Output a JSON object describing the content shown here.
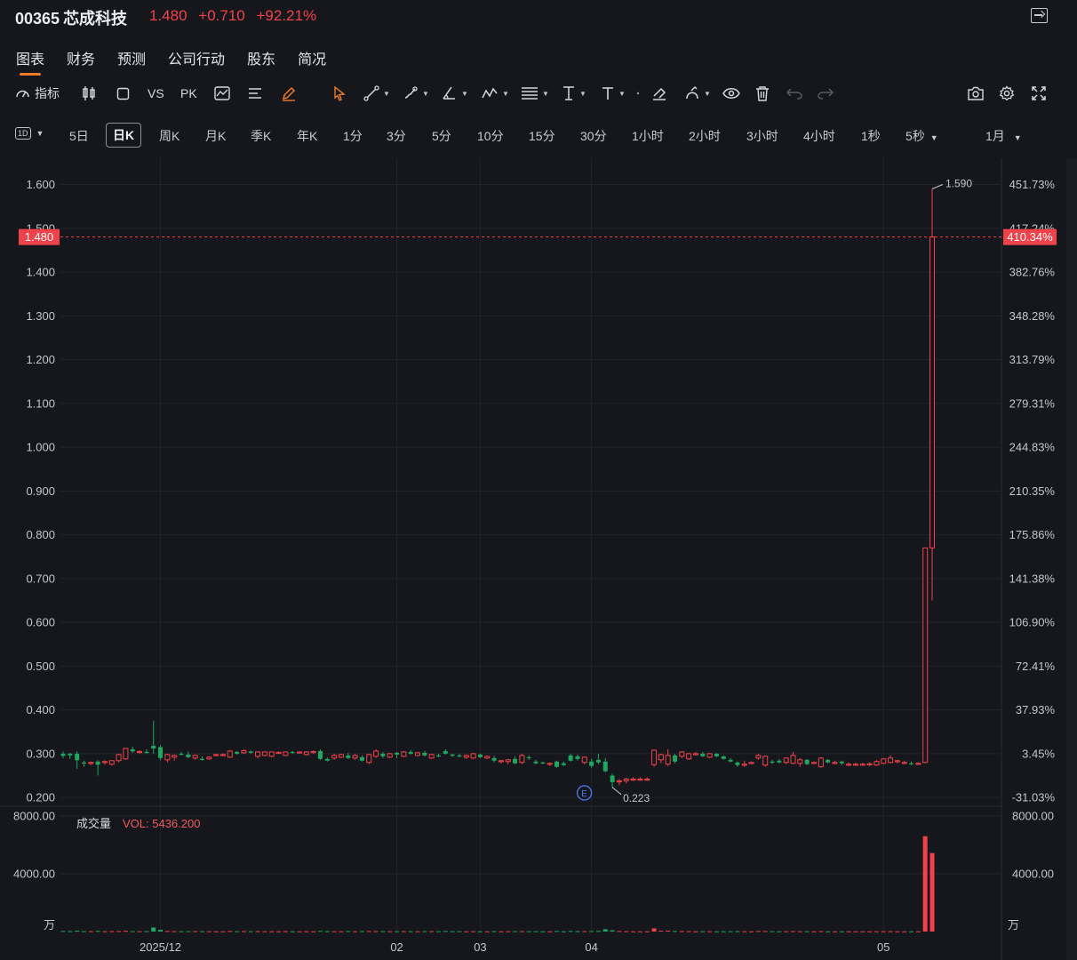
{
  "header": {
    "code": "00365",
    "name": "芯成科技",
    "price": "1.480",
    "change": "+0.710",
    "change_pct": "+92.21%"
  },
  "tabs": [
    "图表",
    "财务",
    "预测",
    "公司行动",
    "股东",
    "简况"
  ],
  "active_tab": "图表",
  "toolbar": {
    "indicator_label": "指标",
    "vs_label": "VS",
    "pk_label": "PK"
  },
  "periods": {
    "interval_selector": "1D",
    "items": [
      "5日",
      "日K",
      "周K",
      "月K",
      "季K",
      "年K",
      "1分",
      "3分",
      "5分",
      "10分",
      "15分",
      "30分",
      "1小时",
      "2小时",
      "3小时",
      "4小时",
      "1秒",
      "5秒"
    ],
    "active": "日K",
    "range": "1月"
  },
  "colors": {
    "up": "#f0424a",
    "down": "#1fa663",
    "accent": "#f07b25",
    "background": "#16171c"
  },
  "chart_data": {
    "type": "candlestick",
    "price_axis": {
      "ticks": [
        "1.600",
        "1.500",
        "1.400",
        "1.300",
        "1.200",
        "1.100",
        "1.000",
        "0.900",
        "0.800",
        "0.700",
        "0.600",
        "0.500",
        "0.400",
        "0.300",
        "0.200"
      ],
      "range": [
        0.18,
        1.66
      ]
    },
    "pct_axis": {
      "ticks": [
        "451.73%",
        "417.24%",
        "382.76%",
        "348.28%",
        "313.79%",
        "279.31%",
        "244.83%",
        "210.35%",
        "175.86%",
        "141.38%",
        "106.90%",
        "72.41%",
        "37.93%",
        "3.45%",
        "-31.03%"
      ]
    },
    "current_price_label": "1.480",
    "current_pct_label": "410.34%",
    "high_label": "1.590",
    "low_label": "0.223",
    "earnings_marker": "E",
    "x_labels": [
      "2025/12",
      "02",
      "03",
      "04",
      "05"
    ],
    "volume": {
      "title": "成交量",
      "indicator": "VOL: 5436.200",
      "axis_ticks": [
        "8000.00",
        "4000.00",
        "万"
      ],
      "range": [
        0,
        8000
      ]
    },
    "candles": [
      {
        "o": 0.3,
        "h": 0.305,
        "l": 0.29,
        "c": 0.295,
        "v": 40
      },
      {
        "o": 0.3,
        "h": 0.302,
        "l": 0.288,
        "c": 0.296,
        "v": 30
      },
      {
        "o": 0.3,
        "h": 0.305,
        "l": 0.265,
        "c": 0.285,
        "v": 60
      },
      {
        "o": 0.28,
        "h": 0.284,
        "l": 0.27,
        "c": 0.278,
        "v": 30
      },
      {
        "o": 0.278,
        "h": 0.282,
        "l": 0.274,
        "c": 0.28,
        "v": 25
      },
      {
        "o": 0.282,
        "h": 0.285,
        "l": 0.25,
        "c": 0.275,
        "v": 45
      },
      {
        "o": 0.28,
        "h": 0.285,
        "l": 0.275,
        "c": 0.282,
        "v": 20
      },
      {
        "o": 0.276,
        "h": 0.285,
        "l": 0.273,
        "c": 0.284,
        "v": 25
      },
      {
        "o": 0.284,
        "h": 0.3,
        "l": 0.28,
        "c": 0.298,
        "v": 35
      },
      {
        "o": 0.288,
        "h": 0.312,
        "l": 0.286,
        "c": 0.312,
        "v": 50
      },
      {
        "o": 0.31,
        "h": 0.316,
        "l": 0.302,
        "c": 0.305,
        "v": 30
      },
      {
        "o": 0.304,
        "h": 0.308,
        "l": 0.3,
        "c": 0.305,
        "v": 20
      },
      {
        "o": 0.304,
        "h": 0.31,
        "l": 0.3,
        "c": 0.302,
        "v": 25
      },
      {
        "o": 0.318,
        "h": 0.375,
        "l": 0.3,
        "c": 0.312,
        "v": 280
      },
      {
        "o": 0.315,
        "h": 0.32,
        "l": 0.285,
        "c": 0.29,
        "v": 120
      },
      {
        "o": 0.286,
        "h": 0.3,
        "l": 0.28,
        "c": 0.298,
        "v": 40
      },
      {
        "o": 0.292,
        "h": 0.298,
        "l": 0.284,
        "c": 0.296,
        "v": 30
      },
      {
        "o": 0.3,
        "h": 0.304,
        "l": 0.296,
        "c": 0.298,
        "v": 20
      },
      {
        "o": 0.298,
        "h": 0.305,
        "l": 0.29,
        "c": 0.292,
        "v": 30
      },
      {
        "o": 0.29,
        "h": 0.298,
        "l": 0.286,
        "c": 0.296,
        "v": 25
      },
      {
        "o": 0.288,
        "h": 0.294,
        "l": 0.284,
        "c": 0.286,
        "v": 20
      },
      {
        "o": 0.288,
        "h": 0.294,
        "l": 0.286,
        "c": 0.292,
        "v": 20
      },
      {
        "o": 0.298,
        "h": 0.3,
        "l": 0.294,
        "c": 0.298,
        "v": 15
      },
      {
        "o": 0.298,
        "h": 0.301,
        "l": 0.296,
        "c": 0.298,
        "v": 15
      },
      {
        "o": 0.292,
        "h": 0.308,
        "l": 0.29,
        "c": 0.306,
        "v": 40
      },
      {
        "o": 0.304,
        "h": 0.306,
        "l": 0.298,
        "c": 0.3,
        "v": 20
      },
      {
        "o": 0.302,
        "h": 0.31,
        "l": 0.3,
        "c": 0.307,
        "v": 30
      },
      {
        "o": 0.305,
        "h": 0.307,
        "l": 0.3,
        "c": 0.302,
        "v": 20
      },
      {
        "o": 0.294,
        "h": 0.306,
        "l": 0.29,
        "c": 0.304,
        "v": 25
      },
      {
        "o": 0.296,
        "h": 0.305,
        "l": 0.294,
        "c": 0.304,
        "v": 20
      },
      {
        "o": 0.294,
        "h": 0.305,
        "l": 0.292,
        "c": 0.304,
        "v": 20
      },
      {
        "o": 0.303,
        "h": 0.305,
        "l": 0.3,
        "c": 0.303,
        "v": 15
      },
      {
        "o": 0.296,
        "h": 0.305,
        "l": 0.294,
        "c": 0.304,
        "v": 25
      },
      {
        "o": 0.304,
        "h": 0.306,
        "l": 0.3,
        "c": 0.302,
        "v": 15
      },
      {
        "o": 0.303,
        "h": 0.305,
        "l": 0.3,
        "c": 0.304,
        "v": 15
      },
      {
        "o": 0.298,
        "h": 0.306,
        "l": 0.296,
        "c": 0.304,
        "v": 20
      },
      {
        "o": 0.304,
        "h": 0.307,
        "l": 0.3,
        "c": 0.305,
        "v": 15
      },
      {
        "o": 0.306,
        "h": 0.31,
        "l": 0.286,
        "c": 0.288,
        "v": 40
      },
      {
        "o": 0.288,
        "h": 0.292,
        "l": 0.282,
        "c": 0.284,
        "v": 25
      },
      {
        "o": 0.29,
        "h": 0.3,
        "l": 0.286,
        "c": 0.296,
        "v": 20
      },
      {
        "o": 0.292,
        "h": 0.3,
        "l": 0.29,
        "c": 0.298,
        "v": 20
      },
      {
        "o": 0.296,
        "h": 0.302,
        "l": 0.288,
        "c": 0.29,
        "v": 30
      },
      {
        "o": 0.29,
        "h": 0.299,
        "l": 0.286,
        "c": 0.296,
        "v": 25
      },
      {
        "o": 0.292,
        "h": 0.296,
        "l": 0.282,
        "c": 0.284,
        "v": 30
      },
      {
        "o": 0.28,
        "h": 0.3,
        "l": 0.276,
        "c": 0.298,
        "v": 35
      },
      {
        "o": 0.294,
        "h": 0.31,
        "l": 0.29,
        "c": 0.306,
        "v": 30
      },
      {
        "o": 0.3,
        "h": 0.304,
        "l": 0.29,
        "c": 0.294,
        "v": 25
      },
      {
        "o": 0.292,
        "h": 0.302,
        "l": 0.29,
        "c": 0.3,
        "v": 20
      },
      {
        "o": 0.302,
        "h": 0.304,
        "l": 0.29,
        "c": 0.298,
        "v": 20
      },
      {
        "o": 0.294,
        "h": 0.306,
        "l": 0.292,
        "c": 0.304,
        "v": 25
      },
      {
        "o": 0.304,
        "h": 0.308,
        "l": 0.298,
        "c": 0.3,
        "v": 20
      },
      {
        "o": 0.296,
        "h": 0.304,
        "l": 0.294,
        "c": 0.302,
        "v": 20
      },
      {
        "o": 0.302,
        "h": 0.306,
        "l": 0.294,
        "c": 0.296,
        "v": 30
      },
      {
        "o": 0.29,
        "h": 0.3,
        "l": 0.288,
        "c": 0.298,
        "v": 25
      },
      {
        "o": 0.296,
        "h": 0.3,
        "l": 0.292,
        "c": 0.294,
        "v": 20
      },
      {
        "o": 0.306,
        "h": 0.31,
        "l": 0.298,
        "c": 0.3,
        "v": 40
      },
      {
        "o": 0.298,
        "h": 0.3,
        "l": 0.292,
        "c": 0.296,
        "v": 20
      },
      {
        "o": 0.296,
        "h": 0.3,
        "l": 0.292,
        "c": 0.294,
        "v": 20
      },
      {
        "o": 0.292,
        "h": 0.298,
        "l": 0.288,
        "c": 0.296,
        "v": 15
      },
      {
        "o": 0.29,
        "h": 0.302,
        "l": 0.288,
        "c": 0.3,
        "v": 20
      },
      {
        "o": 0.298,
        "h": 0.3,
        "l": 0.29,
        "c": 0.292,
        "v": 15
      },
      {
        "o": 0.29,
        "h": 0.296,
        "l": 0.288,
        "c": 0.294,
        "v": 15
      },
      {
        "o": 0.29,
        "h": 0.295,
        "l": 0.28,
        "c": 0.284,
        "v": 25
      },
      {
        "o": 0.282,
        "h": 0.286,
        "l": 0.278,
        "c": 0.284,
        "v": 15
      },
      {
        "o": 0.282,
        "h": 0.288,
        "l": 0.276,
        "c": 0.286,
        "v": 20
      },
      {
        "o": 0.288,
        "h": 0.294,
        "l": 0.276,
        "c": 0.278,
        "v": 30
      },
      {
        "o": 0.28,
        "h": 0.3,
        "l": 0.276,
        "c": 0.296,
        "v": 30
      },
      {
        "o": 0.292,
        "h": 0.296,
        "l": 0.286,
        "c": 0.29,
        "v": 20
      },
      {
        "o": 0.282,
        "h": 0.286,
        "l": 0.276,
        "c": 0.278,
        "v": 20
      },
      {
        "o": 0.28,
        "h": 0.282,
        "l": 0.276,
        "c": 0.278,
        "v": 15
      },
      {
        "o": 0.276,
        "h": 0.28,
        "l": 0.272,
        "c": 0.278,
        "v": 15
      },
      {
        "o": 0.282,
        "h": 0.284,
        "l": 0.268,
        "c": 0.27,
        "v": 40
      },
      {
        "o": 0.278,
        "h": 0.282,
        "l": 0.272,
        "c": 0.274,
        "v": 15
      },
      {
        "o": 0.296,
        "h": 0.3,
        "l": 0.282,
        "c": 0.284,
        "v": 40
      },
      {
        "o": 0.294,
        "h": 0.298,
        "l": 0.284,
        "c": 0.288,
        "v": 25
      },
      {
        "o": 0.28,
        "h": 0.294,
        "l": 0.276,
        "c": 0.292,
        "v": 25
      },
      {
        "o": 0.282,
        "h": 0.288,
        "l": 0.268,
        "c": 0.272,
        "v": 30
      },
      {
        "o": 0.286,
        "h": 0.3,
        "l": 0.276,
        "c": 0.28,
        "v": 40
      },
      {
        "o": 0.282,
        "h": 0.29,
        "l": 0.258,
        "c": 0.26,
        "v": 160
      },
      {
        "o": 0.25,
        "h": 0.254,
        "l": 0.223,
        "c": 0.235,
        "v": 90
      },
      {
        "o": 0.236,
        "h": 0.242,
        "l": 0.228,
        "c": 0.238,
        "v": 40
      },
      {
        "o": 0.238,
        "h": 0.245,
        "l": 0.232,
        "c": 0.242,
        "v": 25
      },
      {
        "o": 0.242,
        "h": 0.246,
        "l": 0.238,
        "c": 0.242,
        "v": 15
      },
      {
        "o": 0.242,
        "h": 0.246,
        "l": 0.238,
        "c": 0.242,
        "v": 15
      },
      {
        "o": 0.242,
        "h": 0.246,
        "l": 0.238,
        "c": 0.242,
        "v": 15
      },
      {
        "o": 0.275,
        "h": 0.31,
        "l": 0.27,
        "c": 0.308,
        "v": 220
      },
      {
        "o": 0.286,
        "h": 0.3,
        "l": 0.278,
        "c": 0.298,
        "v": 60
      },
      {
        "o": 0.276,
        "h": 0.31,
        "l": 0.272,
        "c": 0.296,
        "v": 60
      },
      {
        "o": 0.296,
        "h": 0.3,
        "l": 0.278,
        "c": 0.282,
        "v": 40
      },
      {
        "o": 0.294,
        "h": 0.306,
        "l": 0.29,
        "c": 0.304,
        "v": 30
      },
      {
        "o": 0.288,
        "h": 0.302,
        "l": 0.286,
        "c": 0.3,
        "v": 25
      },
      {
        "o": 0.3,
        "h": 0.304,
        "l": 0.296,
        "c": 0.3,
        "v": 15
      },
      {
        "o": 0.3,
        "h": 0.304,
        "l": 0.292,
        "c": 0.294,
        "v": 20
      },
      {
        "o": 0.292,
        "h": 0.302,
        "l": 0.29,
        "c": 0.3,
        "v": 20
      },
      {
        "o": 0.3,
        "h": 0.302,
        "l": 0.292,
        "c": 0.294,
        "v": 15
      },
      {
        "o": 0.294,
        "h": 0.296,
        "l": 0.286,
        "c": 0.288,
        "v": 20
      },
      {
        "o": 0.286,
        "h": 0.29,
        "l": 0.28,
        "c": 0.282,
        "v": 20
      },
      {
        "o": 0.28,
        "h": 0.282,
        "l": 0.27,
        "c": 0.274,
        "v": 25
      },
      {
        "o": 0.274,
        "h": 0.284,
        "l": 0.27,
        "c": 0.276,
        "v": 20
      },
      {
        "o": 0.28,
        "h": 0.282,
        "l": 0.276,
        "c": 0.28,
        "v": 15
      },
      {
        "o": 0.29,
        "h": 0.3,
        "l": 0.286,
        "c": 0.296,
        "v": 40
      },
      {
        "o": 0.274,
        "h": 0.296,
        "l": 0.27,
        "c": 0.294,
        "v": 35
      },
      {
        "o": 0.282,
        "h": 0.286,
        "l": 0.276,
        "c": 0.28,
        "v": 20
      },
      {
        "o": 0.284,
        "h": 0.288,
        "l": 0.278,
        "c": 0.28,
        "v": 15
      },
      {
        "o": 0.28,
        "h": 0.292,
        "l": 0.276,
        "c": 0.29,
        "v": 20
      },
      {
        "o": 0.278,
        "h": 0.304,
        "l": 0.276,
        "c": 0.296,
        "v": 25
      },
      {
        "o": 0.278,
        "h": 0.29,
        "l": 0.27,
        "c": 0.286,
        "v": 20
      },
      {
        "o": 0.286,
        "h": 0.288,
        "l": 0.274,
        "c": 0.276,
        "v": 20
      },
      {
        "o": 0.278,
        "h": 0.282,
        "l": 0.276,
        "c": 0.28,
        "v": 15
      },
      {
        "o": 0.27,
        "h": 0.292,
        "l": 0.268,
        "c": 0.29,
        "v": 25
      },
      {
        "o": 0.286,
        "h": 0.288,
        "l": 0.278,
        "c": 0.28,
        "v": 15
      },
      {
        "o": 0.28,
        "h": 0.284,
        "l": 0.276,
        "c": 0.28,
        "v": 15
      },
      {
        "o": 0.282,
        "h": 0.284,
        "l": 0.274,
        "c": 0.278,
        "v": 15
      },
      {
        "o": 0.276,
        "h": 0.28,
        "l": 0.272,
        "c": 0.276,
        "v": 15
      },
      {
        "o": 0.276,
        "h": 0.279,
        "l": 0.273,
        "c": 0.276,
        "v": 15
      },
      {
        "o": 0.276,
        "h": 0.279,
        "l": 0.273,
        "c": 0.276,
        "v": 15
      },
      {
        "o": 0.276,
        "h": 0.28,
        "l": 0.272,
        "c": 0.277,
        "v": 15
      },
      {
        "o": 0.274,
        "h": 0.286,
        "l": 0.272,
        "c": 0.282,
        "v": 20
      },
      {
        "o": 0.278,
        "h": 0.29,
        "l": 0.276,
        "c": 0.288,
        "v": 20
      },
      {
        "o": 0.28,
        "h": 0.296,
        "l": 0.278,
        "c": 0.29,
        "v": 25
      },
      {
        "o": 0.282,
        "h": 0.286,
        "l": 0.278,
        "c": 0.284,
        "v": 15
      },
      {
        "o": 0.28,
        "h": 0.284,
        "l": 0.276,
        "c": 0.28,
        "v": 15
      },
      {
        "o": 0.278,
        "h": 0.282,
        "l": 0.274,
        "c": 0.276,
        "v": 15
      },
      {
        "o": 0.276,
        "h": 0.28,
        "l": 0.274,
        "c": 0.278,
        "v": 15
      },
      {
        "o": 0.28,
        "h": 0.77,
        "l": 0.278,
        "c": 0.77,
        "v": 6600
      },
      {
        "o": 0.77,
        "h": 1.59,
        "l": 0.65,
        "c": 1.48,
        "v": 5436.2
      }
    ]
  }
}
